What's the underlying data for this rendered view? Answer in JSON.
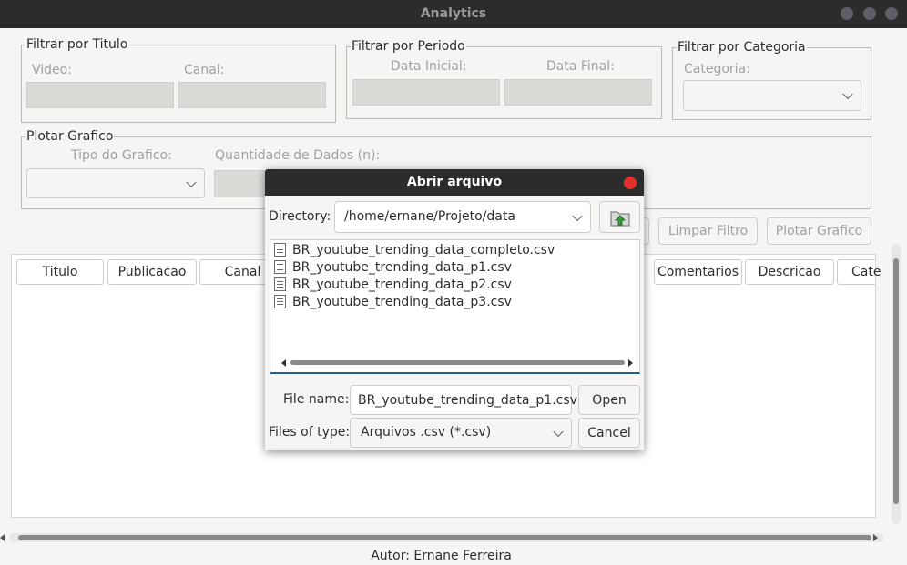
{
  "window": {
    "title": "Analytics"
  },
  "filters": {
    "titulo": {
      "legend": "Filtrar por Titulo",
      "video_label": "Video:",
      "canal_label": "Canal:",
      "video_value": "",
      "canal_value": ""
    },
    "periodo": {
      "legend": "Filtrar por Periodo",
      "inicial_label": "Data Inicial:",
      "final_label": "Data Final:",
      "inicial_value": "",
      "final_value": ""
    },
    "categoria": {
      "legend": "Filtrar por Categoria",
      "label": "Categoria:",
      "value": ""
    }
  },
  "plot": {
    "legend": "Plotar Grafico",
    "tipo_label": "Tipo do Grafico:",
    "quantidade_label": "Quantidade de Dados (n):",
    "tipo_value": "",
    "quantidade_value": ""
  },
  "buttons": {
    "limpar_filtro": "Limpar Filtro",
    "plotar_grafico": "Plotar Grafico"
  },
  "table": {
    "columns": [
      "Titulo",
      "Publicacao",
      "Canal",
      "Comentarios",
      "Descricao",
      "Cate"
    ]
  },
  "footer": {
    "author": "Autor: Ernane Ferreira"
  },
  "dialog": {
    "title": "Abrir arquivo",
    "directory_label": "Directory:",
    "directory_value": "/home/ernane/Projeto/data",
    "files": [
      "BR_youtube_trending_data_completo.csv",
      "BR_youtube_trending_data_p1.csv",
      "BR_youtube_trending_data_p2.csv",
      "BR_youtube_trending_data_p3.csv"
    ],
    "filename_label": "File name:",
    "filename_value": "BR_youtube_trending_data_p1.csv",
    "filetype_label": "Files of type:",
    "filetype_value": "Arquivos .csv (*.csv)",
    "open_label": "Open",
    "cancel_label": "Cancel"
  },
  "colors": {
    "titlebar": "#2c2c2c",
    "window_bg": "#f6f5f4",
    "close_red": "#e0302e",
    "focus_blue": "#1c5f95"
  }
}
